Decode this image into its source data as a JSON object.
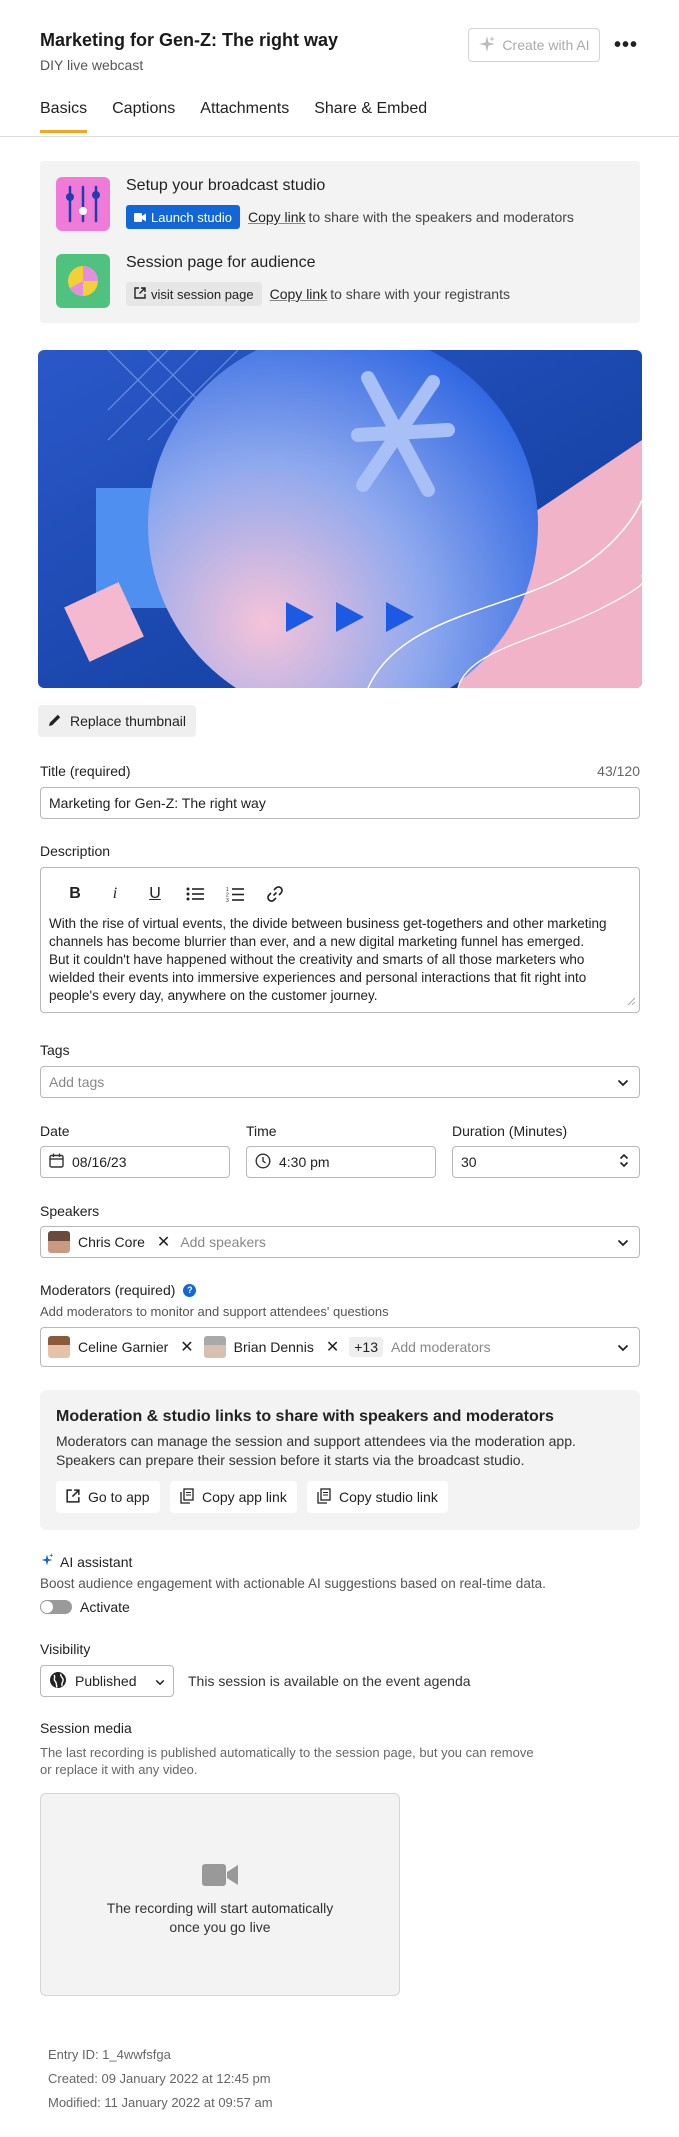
{
  "header": {
    "title": "Marketing for Gen-Z: The right way",
    "subtitle": "DIY live webcast",
    "ai_button_label": "Create with AI",
    "more_label": "•••"
  },
  "tabs": [
    {
      "label": "Basics",
      "active": true
    },
    {
      "label": "Captions",
      "active": false
    },
    {
      "label": "Attachments",
      "active": false
    },
    {
      "label": "Share & Embed",
      "active": false
    }
  ],
  "studio": {
    "broadcast_title": "Setup your broadcast studio",
    "launch_label": "Launch studio",
    "copy_link_label": "Copy link",
    "broadcast_copy_text": "to share with the speakers and moderators",
    "session_title": "Session page for audience",
    "visit_label": "visit session page",
    "session_copy_text": "to share with your registrants"
  },
  "thumbnail": {
    "replace_label": "Replace thumbnail"
  },
  "title_field": {
    "label": "Title (required)",
    "counter": "43/120",
    "value": "Marketing for Gen-Z: The right way"
  },
  "description": {
    "label": "Description",
    "text_line1": "With the rise of virtual events, the divide between business get-togethers and other marketing channels has become blurrier than ever, and a new digital marketing funnel has emerged.",
    "text_line2": "But it couldn't have happened without the creativity and smarts of all those marketers who wielded their events into immersive experiences and personal interactions that fit right into people's every day, anywhere on the customer journey."
  },
  "tags": {
    "label": "Tags",
    "placeholder": "Add tags"
  },
  "date": {
    "label": "Date",
    "value": "08/16/23"
  },
  "time": {
    "label": "Time",
    "value": "4:30 pm"
  },
  "duration": {
    "label": "Duration (Minutes)",
    "value": "30"
  },
  "speakers": {
    "label": "Speakers",
    "chips": [
      "Chris Core"
    ],
    "placeholder": "Add speakers"
  },
  "moderators": {
    "label": "Moderators (required)",
    "help": "?",
    "hint": "Add moderators to monitor and support attendees' questions",
    "chips": [
      "Celine Garnier",
      "Brian Dennis"
    ],
    "more_count": "+13",
    "placeholder": "Add moderators"
  },
  "mod_box": {
    "title": "Moderation & studio links to share with speakers and moderators",
    "text_line1": "Moderators can manage the session and support attendees via the moderation app.",
    "text_line2": "Speakers can prepare their session before it starts via the broadcast studio.",
    "go_label": "Go to app",
    "copy_app_label": "Copy app link",
    "copy_studio_label": "Copy studio link"
  },
  "ai_assistant": {
    "title": "AI assistant",
    "description": "Boost audience engagement with actionable AI suggestions based on real-time data.",
    "toggle_label": "Activate",
    "enabled": false
  },
  "visibility": {
    "label": "Visibility",
    "value": "Published",
    "note": "This session is available on the event agenda"
  },
  "session_media": {
    "label": "Session media",
    "hint_line1": "The last recording is published automatically to the session page, but you can remove",
    "hint_line2": "or replace it with any video.",
    "empty_line1": "The recording will start automatically",
    "empty_line2": "once you go live"
  },
  "meta": {
    "entry_id": "Entry ID: 1_4wwfsfga",
    "created": "Created: 09 January 2022 at 12:45 pm",
    "modified": "Modified: 11 January 2022 at 09:57 am"
  },
  "colors": {
    "accent_tab": "#f5a623",
    "primary_button": "#1266d6",
    "panel_bg": "#f3f3f3"
  }
}
